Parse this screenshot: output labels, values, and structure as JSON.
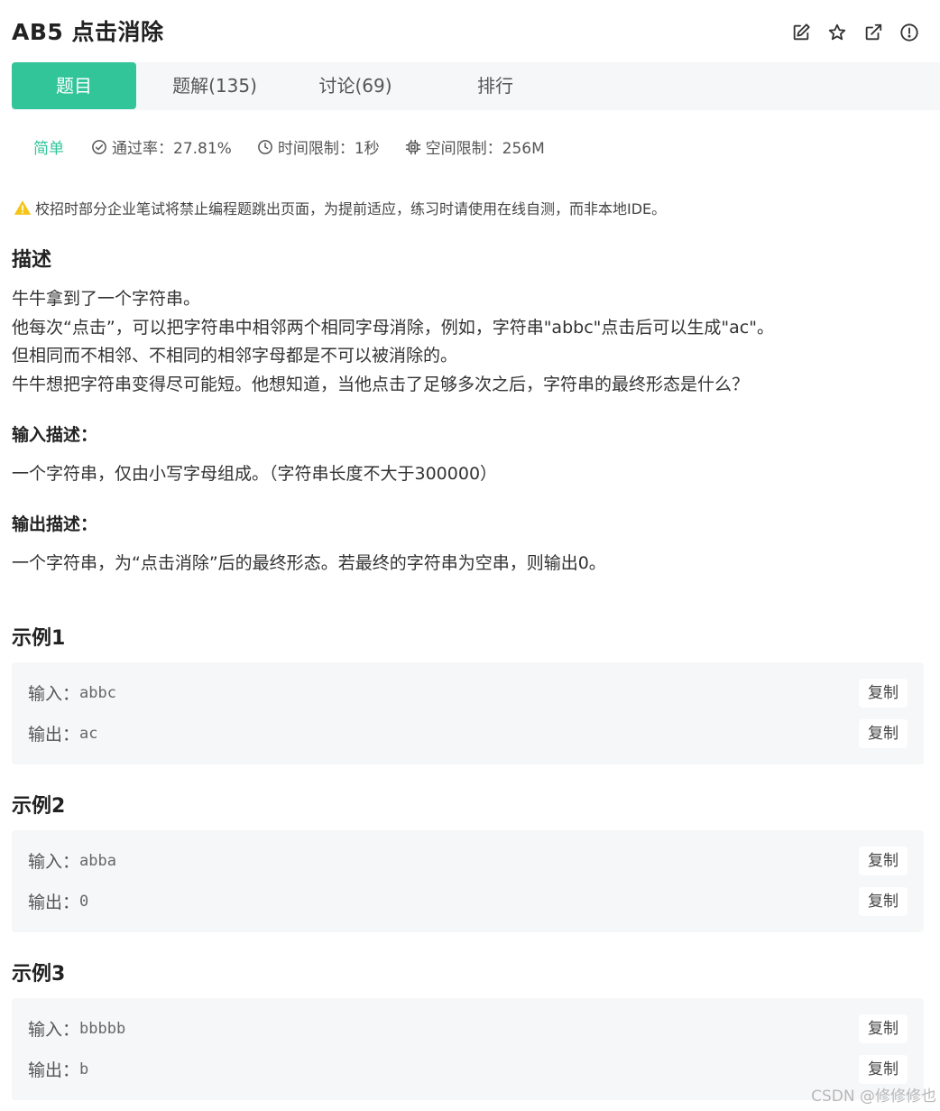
{
  "problem": {
    "id_title": "AB5  点击消除"
  },
  "header_icons": [
    "edit-icon",
    "star-icon",
    "external-link-icon",
    "alert-circle-icon"
  ],
  "tabs": [
    {
      "label": "题目",
      "active": true
    },
    {
      "label": "题解(135)",
      "active": false
    },
    {
      "label": "讨论(69)",
      "active": false
    },
    {
      "label": "排行",
      "active": false
    }
  ],
  "meta": {
    "difficulty": "简单",
    "pass_rate": "通过率：27.81%",
    "time_limit": "时间限制：1秒",
    "space_limit": "空间限制：256M"
  },
  "warning": "校招时部分企业笔试将禁止编程题跳出页面，为提前适应，练习时请使用在线自测，而非本地IDE。",
  "description": {
    "title": "描述",
    "lines": [
      "牛牛拿到了一个字符串。",
      "他每次“点击”，可以把字符串中相邻两个相同字母消除，例如，字符串\"abbc\"点击后可以生成\"ac\"。",
      "但相同而不相邻、不相同的相邻字母都是不可以被消除的。",
      "牛牛想把字符串变得尽可能短。他想知道，当他点击了足够多次之后，字符串的最终形态是什么？"
    ]
  },
  "input_desc": {
    "title": "输入描述：",
    "text": "一个字符串，仅由小写字母组成。（字符串长度不大于300000）"
  },
  "output_desc": {
    "title": "输出描述：",
    "text": "一个字符串，为“点击消除”后的最终形态。若最终的字符串为空串，则输出0。"
  },
  "examples": [
    {
      "title": "示例1",
      "input_label": "输入：",
      "input": "abbc",
      "output_label": "输出：",
      "output": "ac",
      "copy": "复制"
    },
    {
      "title": "示例2",
      "input_label": "输入：",
      "input": "abba",
      "output_label": "输出：",
      "output": "0",
      "copy": "复制"
    },
    {
      "title": "示例3",
      "input_label": "输入：",
      "input": "bbbbb",
      "output_label": "输出：",
      "output": "b",
      "copy": "复制"
    }
  ],
  "watermark": "CSDN @修修修也",
  "colors": {
    "accent": "#32c59a",
    "warning": "#f5c518"
  }
}
